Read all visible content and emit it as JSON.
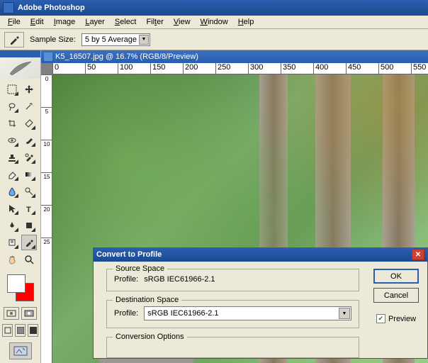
{
  "app": {
    "title": "Adobe Photoshop"
  },
  "menu": {
    "file": "File",
    "edit": "Edit",
    "image": "Image",
    "layer": "Layer",
    "select": "Select",
    "filter": "Filter",
    "view": "View",
    "window": "Window",
    "help": "Help"
  },
  "options": {
    "sample_label": "Sample Size:",
    "sample_value": "5 by 5 Average"
  },
  "document": {
    "title": "K5_16507.jpg @ 16.7% (RGB/8/Preview)"
  },
  "ruler_h": [
    "0",
    "50",
    "100",
    "150",
    "200",
    "250",
    "300",
    "350",
    "400",
    "450",
    "500",
    "550"
  ],
  "ruler_v": [
    "0",
    "5",
    "10",
    "15",
    "20",
    "25"
  ],
  "dialog": {
    "title": "Convert to Profile",
    "source_legend": "Source Space",
    "source_profile_label": "Profile:",
    "source_profile_value": "sRGB IEC61966-2.1",
    "dest_legend": "Destination Space",
    "dest_profile_label": "Profile:",
    "dest_profile_value": "sRGB IEC61966-2.1",
    "conv_legend": "Conversion Options",
    "ok": "OK",
    "cancel": "Cancel",
    "preview": "Preview"
  }
}
